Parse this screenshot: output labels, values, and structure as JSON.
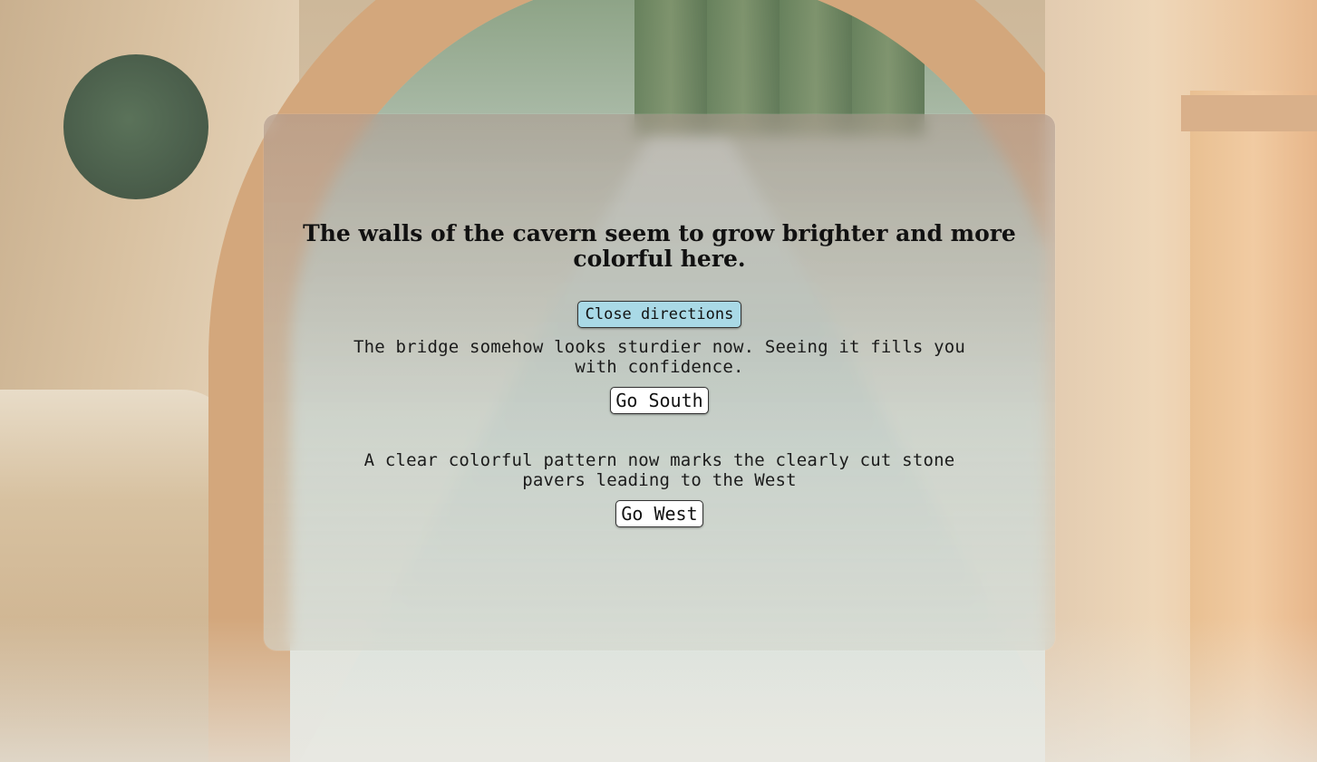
{
  "scene": {
    "headline": "The walls of the cavern seem to grow brighter and more colorful here.",
    "close_directions_label": "Close directions",
    "options": [
      {
        "text": "The bridge somehow looks sturdier now. Seeing it fills you with confidence.",
        "button_label": "Go South"
      },
      {
        "text": "A clear colorful pattern now marks the clearly cut stone pavers leading to the West",
        "button_label": "Go West"
      }
    ]
  },
  "colors": {
    "close_button_bg": "#a9d9e6",
    "go_button_bg": "#ffffff",
    "text": "#111111"
  }
}
